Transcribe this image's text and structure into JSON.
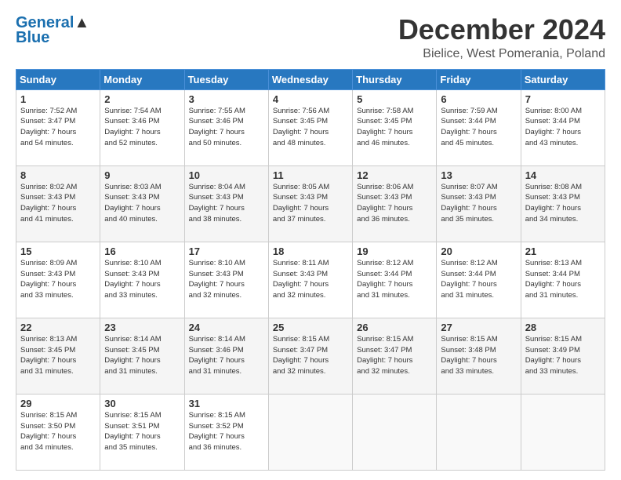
{
  "logo": {
    "line1": "General",
    "line2": "Blue"
  },
  "title": "December 2024",
  "subtitle": "Bielice, West Pomerania, Poland",
  "weekdays": [
    "Sunday",
    "Monday",
    "Tuesday",
    "Wednesday",
    "Thursday",
    "Friday",
    "Saturday"
  ],
  "weeks": [
    [
      {
        "day": "1",
        "info": "Sunrise: 7:52 AM\nSunset: 3:47 PM\nDaylight: 7 hours\nand 54 minutes."
      },
      {
        "day": "2",
        "info": "Sunrise: 7:54 AM\nSunset: 3:46 PM\nDaylight: 7 hours\nand 52 minutes."
      },
      {
        "day": "3",
        "info": "Sunrise: 7:55 AM\nSunset: 3:46 PM\nDaylight: 7 hours\nand 50 minutes."
      },
      {
        "day": "4",
        "info": "Sunrise: 7:56 AM\nSunset: 3:45 PM\nDaylight: 7 hours\nand 48 minutes."
      },
      {
        "day": "5",
        "info": "Sunrise: 7:58 AM\nSunset: 3:45 PM\nDaylight: 7 hours\nand 46 minutes."
      },
      {
        "day": "6",
        "info": "Sunrise: 7:59 AM\nSunset: 3:44 PM\nDaylight: 7 hours\nand 45 minutes."
      },
      {
        "day": "7",
        "info": "Sunrise: 8:00 AM\nSunset: 3:44 PM\nDaylight: 7 hours\nand 43 minutes."
      }
    ],
    [
      {
        "day": "8",
        "info": "Sunrise: 8:02 AM\nSunset: 3:43 PM\nDaylight: 7 hours\nand 41 minutes."
      },
      {
        "day": "9",
        "info": "Sunrise: 8:03 AM\nSunset: 3:43 PM\nDaylight: 7 hours\nand 40 minutes."
      },
      {
        "day": "10",
        "info": "Sunrise: 8:04 AM\nSunset: 3:43 PM\nDaylight: 7 hours\nand 38 minutes."
      },
      {
        "day": "11",
        "info": "Sunrise: 8:05 AM\nSunset: 3:43 PM\nDaylight: 7 hours\nand 37 minutes."
      },
      {
        "day": "12",
        "info": "Sunrise: 8:06 AM\nSunset: 3:43 PM\nDaylight: 7 hours\nand 36 minutes."
      },
      {
        "day": "13",
        "info": "Sunrise: 8:07 AM\nSunset: 3:43 PM\nDaylight: 7 hours\nand 35 minutes."
      },
      {
        "day": "14",
        "info": "Sunrise: 8:08 AM\nSunset: 3:43 PM\nDaylight: 7 hours\nand 34 minutes."
      }
    ],
    [
      {
        "day": "15",
        "info": "Sunrise: 8:09 AM\nSunset: 3:43 PM\nDaylight: 7 hours\nand 33 minutes."
      },
      {
        "day": "16",
        "info": "Sunrise: 8:10 AM\nSunset: 3:43 PM\nDaylight: 7 hours\nand 33 minutes."
      },
      {
        "day": "17",
        "info": "Sunrise: 8:10 AM\nSunset: 3:43 PM\nDaylight: 7 hours\nand 32 minutes."
      },
      {
        "day": "18",
        "info": "Sunrise: 8:11 AM\nSunset: 3:43 PM\nDaylight: 7 hours\nand 32 minutes."
      },
      {
        "day": "19",
        "info": "Sunrise: 8:12 AM\nSunset: 3:44 PM\nDaylight: 7 hours\nand 31 minutes."
      },
      {
        "day": "20",
        "info": "Sunrise: 8:12 AM\nSunset: 3:44 PM\nDaylight: 7 hours\nand 31 minutes."
      },
      {
        "day": "21",
        "info": "Sunrise: 8:13 AM\nSunset: 3:44 PM\nDaylight: 7 hours\nand 31 minutes."
      }
    ],
    [
      {
        "day": "22",
        "info": "Sunrise: 8:13 AM\nSunset: 3:45 PM\nDaylight: 7 hours\nand 31 minutes."
      },
      {
        "day": "23",
        "info": "Sunrise: 8:14 AM\nSunset: 3:45 PM\nDaylight: 7 hours\nand 31 minutes."
      },
      {
        "day": "24",
        "info": "Sunrise: 8:14 AM\nSunset: 3:46 PM\nDaylight: 7 hours\nand 31 minutes."
      },
      {
        "day": "25",
        "info": "Sunrise: 8:15 AM\nSunset: 3:47 PM\nDaylight: 7 hours\nand 32 minutes."
      },
      {
        "day": "26",
        "info": "Sunrise: 8:15 AM\nSunset: 3:47 PM\nDaylight: 7 hours\nand 32 minutes."
      },
      {
        "day": "27",
        "info": "Sunrise: 8:15 AM\nSunset: 3:48 PM\nDaylight: 7 hours\nand 33 minutes."
      },
      {
        "day": "28",
        "info": "Sunrise: 8:15 AM\nSunset: 3:49 PM\nDaylight: 7 hours\nand 33 minutes."
      }
    ],
    [
      {
        "day": "29",
        "info": "Sunrise: 8:15 AM\nSunset: 3:50 PM\nDaylight: 7 hours\nand 34 minutes."
      },
      {
        "day": "30",
        "info": "Sunrise: 8:15 AM\nSunset: 3:51 PM\nDaylight: 7 hours\nand 35 minutes."
      },
      {
        "day": "31",
        "info": "Sunrise: 8:15 AM\nSunset: 3:52 PM\nDaylight: 7 hours\nand 36 minutes."
      },
      {
        "day": "",
        "info": ""
      },
      {
        "day": "",
        "info": ""
      },
      {
        "day": "",
        "info": ""
      },
      {
        "day": "",
        "info": ""
      }
    ]
  ]
}
